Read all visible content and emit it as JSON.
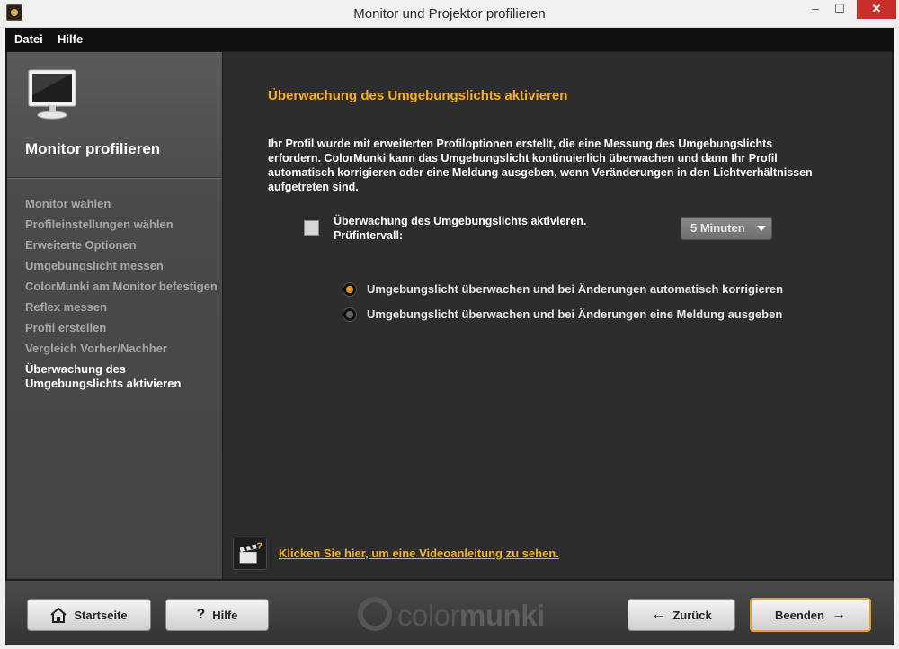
{
  "window": {
    "title": "Monitor und Projektor profilieren",
    "minimize_label": "–",
    "maximize_label": "☐",
    "close_label": "✕"
  },
  "menu": {
    "items": [
      "Datei",
      "Hilfe"
    ]
  },
  "sidebar": {
    "title": "Monitor profilieren",
    "steps": [
      "Monitor wählen",
      "Profileinstellungen wählen",
      "Erweiterte Optionen",
      "Umgebungslicht messen",
      "ColorMunki am Monitor befestigen",
      "Reflex messen",
      "Profil erstellen",
      "Vergleich Vorher/Nachher",
      "Überwachung des Umgebungslichts aktivieren"
    ],
    "active_step": "Überwachung des Umgebungslichts aktivieren"
  },
  "main": {
    "heading": "Überwachung des Umgebungslichts aktivieren",
    "intro": "Ihr Profil wurde mit erweiterten Profiloptionen erstellt, die eine Messung des Umgebungslichts erfordern. ColorMunki kann das Umgebungslicht kontinuierlich überwachen und dann Ihr Profil automatisch korrigieren oder eine Meldung ausgeben, wenn Veränderungen in den Lichtverhältnissen aufgetreten sind.",
    "checkbox": {
      "line1": "Überwachung des Umgebungslichts aktivieren.",
      "line2": "Prüfintervall:",
      "checked": false
    },
    "interval": {
      "value": "5 Minuten"
    },
    "radio_options": [
      {
        "label": "Umgebungslicht überwachen und bei Änderungen automatisch korrigieren",
        "selected": true
      },
      {
        "label": "Umgebungslicht überwachen und bei Änderungen eine Meldung ausgeben",
        "selected": false
      }
    ],
    "video_link": "Klicken Sie hier, um eine Videoanleitung zu sehen."
  },
  "footer": {
    "home_label": "Startseite",
    "help_label": "Hilfe",
    "back_label": "Zurück",
    "finish_label": "Beenden",
    "logo_light": "color",
    "logo_bold": "munki"
  },
  "colors": {
    "accent": "#f5b023",
    "radio_selected": "#e89318"
  }
}
